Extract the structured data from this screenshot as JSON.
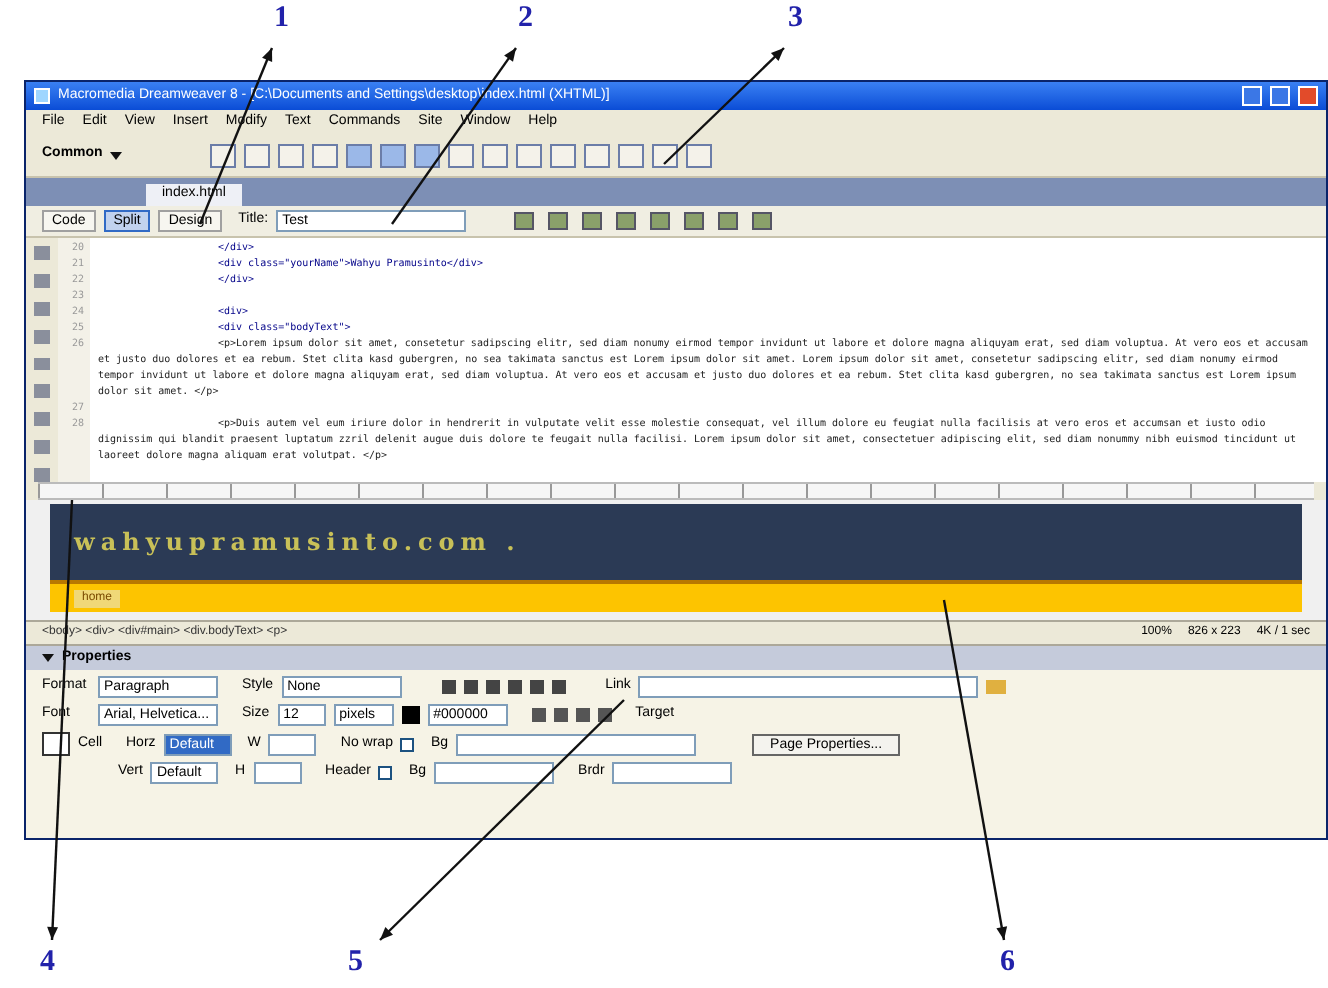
{
  "annotations": [
    {
      "label": "1"
    },
    {
      "label": "2"
    },
    {
      "label": "3"
    },
    {
      "label": "4"
    },
    {
      "label": "5"
    },
    {
      "label": "6"
    }
  ],
  "window": {
    "title": "Macromedia Dreamweaver 8 - [C:\\Documents and Settings\\desktop\\index.html (XHTML)]"
  },
  "menu": [
    "File",
    "Edit",
    "View",
    "Insert",
    "Modify",
    "Text",
    "Commands",
    "Site",
    "Window",
    "Help"
  ],
  "insert_bar": {
    "category": "Common"
  },
  "doc_tabs": [
    {
      "label": "index.html",
      "selected": true
    }
  ],
  "doc_toolbar": {
    "views": [
      {
        "label": "Code",
        "selected": false
      },
      {
        "label": "Split",
        "selected": true
      },
      {
        "label": "Design",
        "selected": false
      }
    ],
    "title_label": "Title:",
    "title_value": "Test"
  },
  "code": {
    "lines": [
      {
        "number": "20",
        "kind": "tag",
        "text": "</div>"
      },
      {
        "number": "21",
        "kind": "tag",
        "text": "<div class=\"yourName\">Wahyu Pramusinto</div>"
      },
      {
        "number": "22",
        "kind": "tag",
        "text": "</div>"
      },
      {
        "number": "23",
        "kind": "blank"
      },
      {
        "number": "24",
        "kind": "tag",
        "text": "<div>"
      },
      {
        "number": "25",
        "kind": "tag",
        "text": "<div class=\"bodyText\">"
      },
      {
        "number": "26",
        "kind": "para",
        "text": "<p>Lorem ipsum dolor sit amet, consetetur sadipscing elitr, sed diam nonumy eirmod tempor invidunt ut labore et dolore magna aliquyam erat, sed diam voluptua. At vero eos et accusam et justo duo dolores et ea rebum. Stet clita kasd gubergren, no sea takimata sanctus est Lorem ipsum dolor sit amet. Lorem ipsum dolor sit amet, consetetur sadipscing elitr, sed diam nonumy eirmod tempor invidunt ut labore et dolore magna aliquyam erat, sed diam voluptua. At vero eos et accusam et justo duo dolores et ea rebum. Stet clita kasd gubergren, no sea takimata sanctus est Lorem ipsum dolor sit amet. </p>"
      },
      {
        "number": "27",
        "kind": "blank"
      },
      {
        "number": "28",
        "kind": "para",
        "text": "<p>Duis autem vel eum iriure dolor in hendrerit in vulputate velit esse molestie consequat, vel illum dolore eu feugiat nulla facilisis at vero eros et accumsan et iusto odio dignissim qui blandit praesent luptatum zzril delenit augue duis dolore te feugait nulla facilisi. Lorem ipsum dolor sit amet, consectetuer adipiscing elit, sed diam nonummy nibh euismod tincidunt ut laoreet dolore magna aliquam erat volutpat. </p>"
      }
    ]
  },
  "design": {
    "site_name": "wahyupramusinto.com .",
    "nav_item": "home"
  },
  "status_bar": {
    "tags": "<body> <div> <div#main> <div.bodyText> <p>",
    "zoom": "100%",
    "size": "826 x 223",
    "weight": "4K / 1 sec"
  },
  "properties": {
    "title": "Properties",
    "row1": {
      "format_label": "Format",
      "format": "Paragraph",
      "style_label": "Style",
      "style": "None",
      "link_label": "Link"
    },
    "row2": {
      "font_label": "Font",
      "font": "Arial, Helvetica...",
      "size_label": "Size",
      "size": "12",
      "unit": "pixels",
      "color": "#000000",
      "target_label": "Target"
    },
    "row3": {
      "cell_label": "Cell",
      "horz_label": "Horz",
      "horz": "Default",
      "w_label": "W",
      "nowrap_label": "No wrap",
      "nowrap_checked": false,
      "bg_label": "Bg",
      "page_button": "Page Properties..."
    },
    "row4": {
      "vert_label": "Vert",
      "vert": "Default",
      "h_label": "H",
      "header_label": "Header",
      "header_checked": false,
      "bg_label": "Bg",
      "brdr_label": "Brdr"
    }
  }
}
